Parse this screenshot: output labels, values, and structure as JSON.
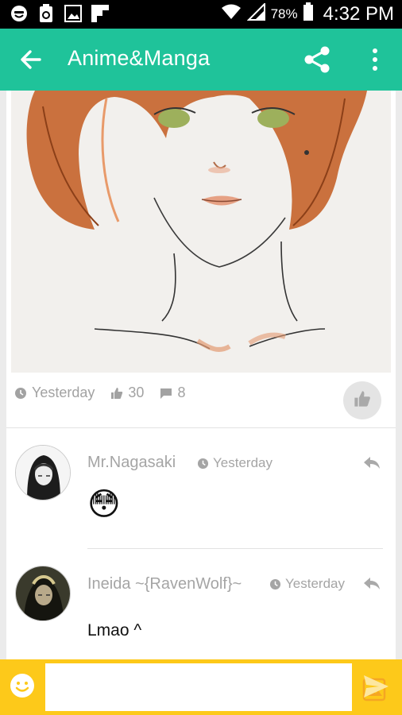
{
  "status_bar": {
    "icons_left": [
      "emoji-notification-icon",
      "battery-saver-icon",
      "gallery-icon",
      "flipboard-icon"
    ],
    "battery_percent": "78%",
    "time": "4:32 PM"
  },
  "app_bar": {
    "title": "Anime&Manga",
    "back_icon": "arrow-left",
    "share_icon": "share",
    "more_icon": "more-vertical",
    "color": "#1fc39a"
  },
  "post": {
    "image_alt": "drawing of a girl with short auburn hair",
    "time": "Yesterday",
    "likes": "30",
    "comments": "8"
  },
  "comments": [
    {
      "author": "Mr.Nagasaki",
      "time": "Yesterday",
      "text": "😳"
    },
    {
      "author": "Ineida ~{RavenWolf}~",
      "time": "Yesterday",
      "text": "Lmao ^"
    }
  ],
  "input": {
    "placeholder": "",
    "color": "#fdc91a"
  }
}
